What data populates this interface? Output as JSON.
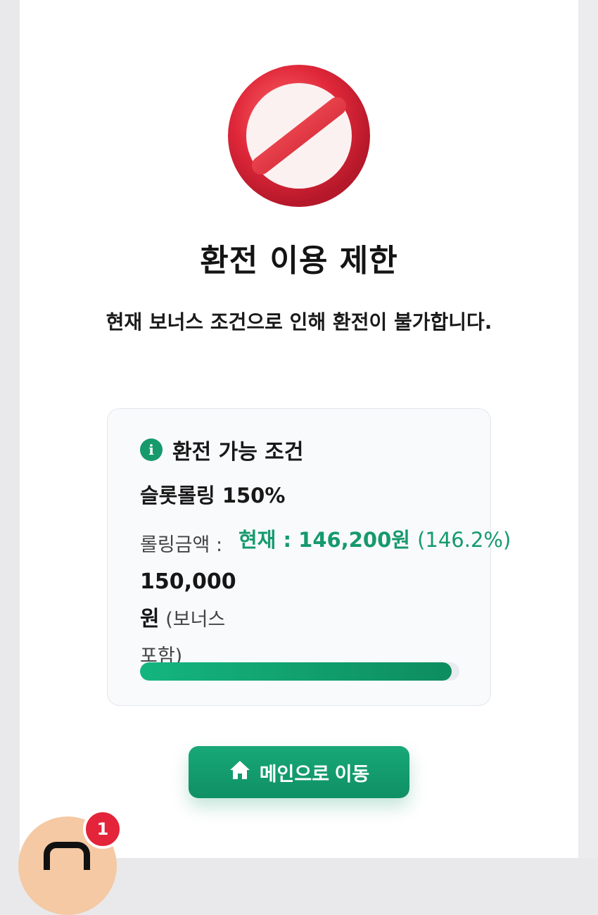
{
  "dialog": {
    "title": "환전 이용 제한",
    "message": "현재 보너스 조건으로 인해 환전이 불가합니다."
  },
  "condition_card": {
    "heading": "환전 가능 조건",
    "condition": "슬롯롤링 150%",
    "required_label": "롤링금액 :",
    "required_amount": "150,000 원",
    "required_note": "(보너스 포함)",
    "current_label": "현재 :",
    "current_amount": "146,200원",
    "current_percent": "(146.2%)",
    "progress_fraction": 0.975
  },
  "buttons": {
    "main_label": "메인으로 이동"
  },
  "notifications": {
    "badge_count": "1"
  },
  "icons": {
    "forbidden": "prohibited-icon",
    "info": "info-icon",
    "home": "home-icon"
  },
  "colors": {
    "accent": "#169a6c",
    "forbidden_red": "#e0283a",
    "badge_red": "#e3243a"
  }
}
